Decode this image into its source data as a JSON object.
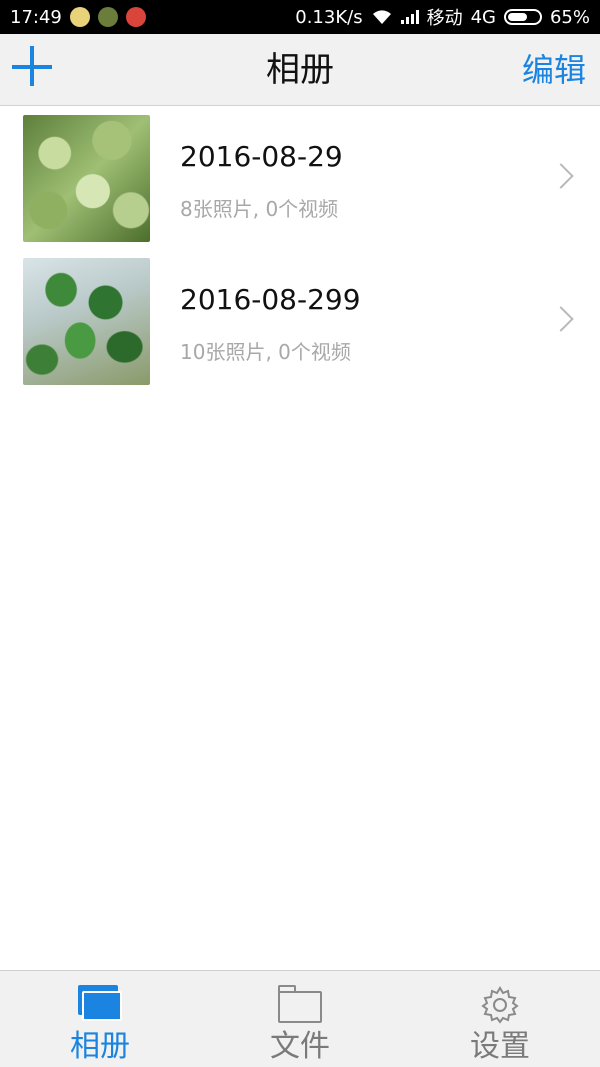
{
  "status_bar": {
    "time": "17:49",
    "net_speed": "0.13K/s",
    "carrier": "移动",
    "network": "4G",
    "battery": "65%",
    "battery_level": 0.65,
    "notification_icons": [
      "app-notif-icon-1",
      "app-notif-icon-2",
      "app-notif-icon-3"
    ]
  },
  "nav": {
    "add_icon": "plus-icon",
    "title": "相册",
    "edit_label": "编辑"
  },
  "albums": [
    {
      "title": "2016-08-29",
      "subtitle": "8张照片, 0个视频"
    },
    {
      "title": "2016-08-299",
      "subtitle": "10张照片, 0个视频"
    }
  ],
  "tabs": [
    {
      "label": "相册",
      "icon": "album-icon",
      "active": true
    },
    {
      "label": "文件",
      "icon": "folder-icon",
      "active": false
    },
    {
      "label": "设置",
      "icon": "gear-icon",
      "active": false
    }
  ],
  "colors": {
    "accent": "#1a84e0",
    "nav_bg": "#f1f1f1",
    "subtitle_gray": "#a8a8a8"
  }
}
